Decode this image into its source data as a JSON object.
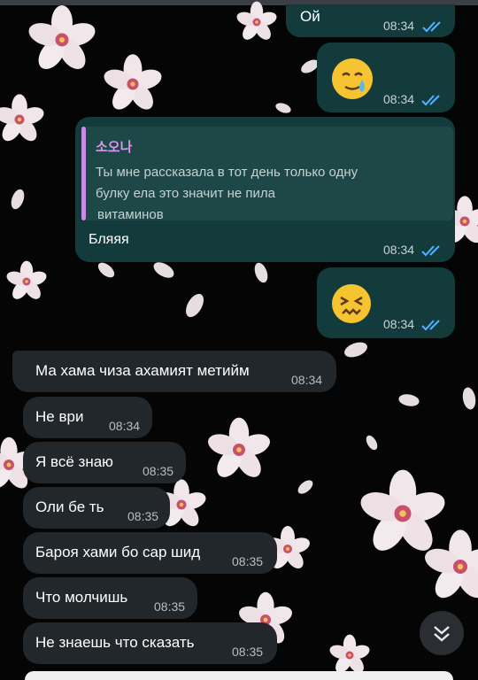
{
  "colors": {
    "outgoing_bubble": "#143b3c",
    "incoming_bubble": "#22272c",
    "read_ticks": "#4fb3ff",
    "quote_accent": "#c98ce6"
  },
  "outgoing": [
    {
      "text": "Ой",
      "time": "08:34"
    },
    {
      "emoji": "smiling-face-with-tear",
      "time": "08:34"
    },
    {
      "reply_author": "소오나",
      "reply_lines": [
        "Ты мне рассказала в тот день только одну",
        "булку ела это значит не пила",
        "витаминов"
      ],
      "text": "Бляяя",
      "time": "08:34"
    },
    {
      "emoji": "confounded-face",
      "time": "08:34"
    }
  ],
  "incoming": [
    {
      "text": "Ма хама чиза ахамият метийм",
      "time": "08:34"
    },
    {
      "text": "Не ври",
      "time": "08:34"
    },
    {
      "text": "Я всё знаю",
      "time": "08:35"
    },
    {
      "text": "Оли бе ть",
      "time": "08:35"
    },
    {
      "text": "Бароя хами бо сар шид",
      "time": "08:35"
    },
    {
      "text": "Что молчишь",
      "time": "08:35"
    },
    {
      "text": "Не знаешь что сказать",
      "time": "08:35"
    }
  ],
  "status": {
    "read_icon": "double-check-icon"
  },
  "scroll_button_icon": "chevron-double-down-icon"
}
